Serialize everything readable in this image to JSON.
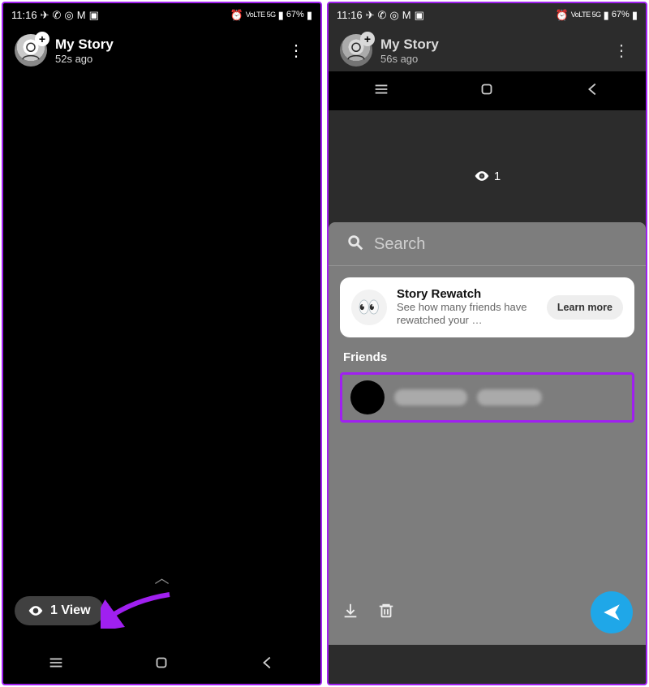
{
  "status": {
    "time": "11:16",
    "signal_label": "VoLTE 5G",
    "battery": "67%"
  },
  "left": {
    "title": "My Story",
    "subtitle": "52s ago",
    "view_count_label": "1 View"
  },
  "right": {
    "title": "My Story",
    "subtitle": "56s ago",
    "overlay_ago": "56s ago",
    "overlay_view_count": "1",
    "search_placeholder": "Search",
    "rewatch": {
      "title": "Story Rewatch",
      "subtitle": "See how many friends have rewatched your …",
      "cta": "Learn more",
      "emoji": "👀"
    },
    "friends_label": "Friends"
  }
}
